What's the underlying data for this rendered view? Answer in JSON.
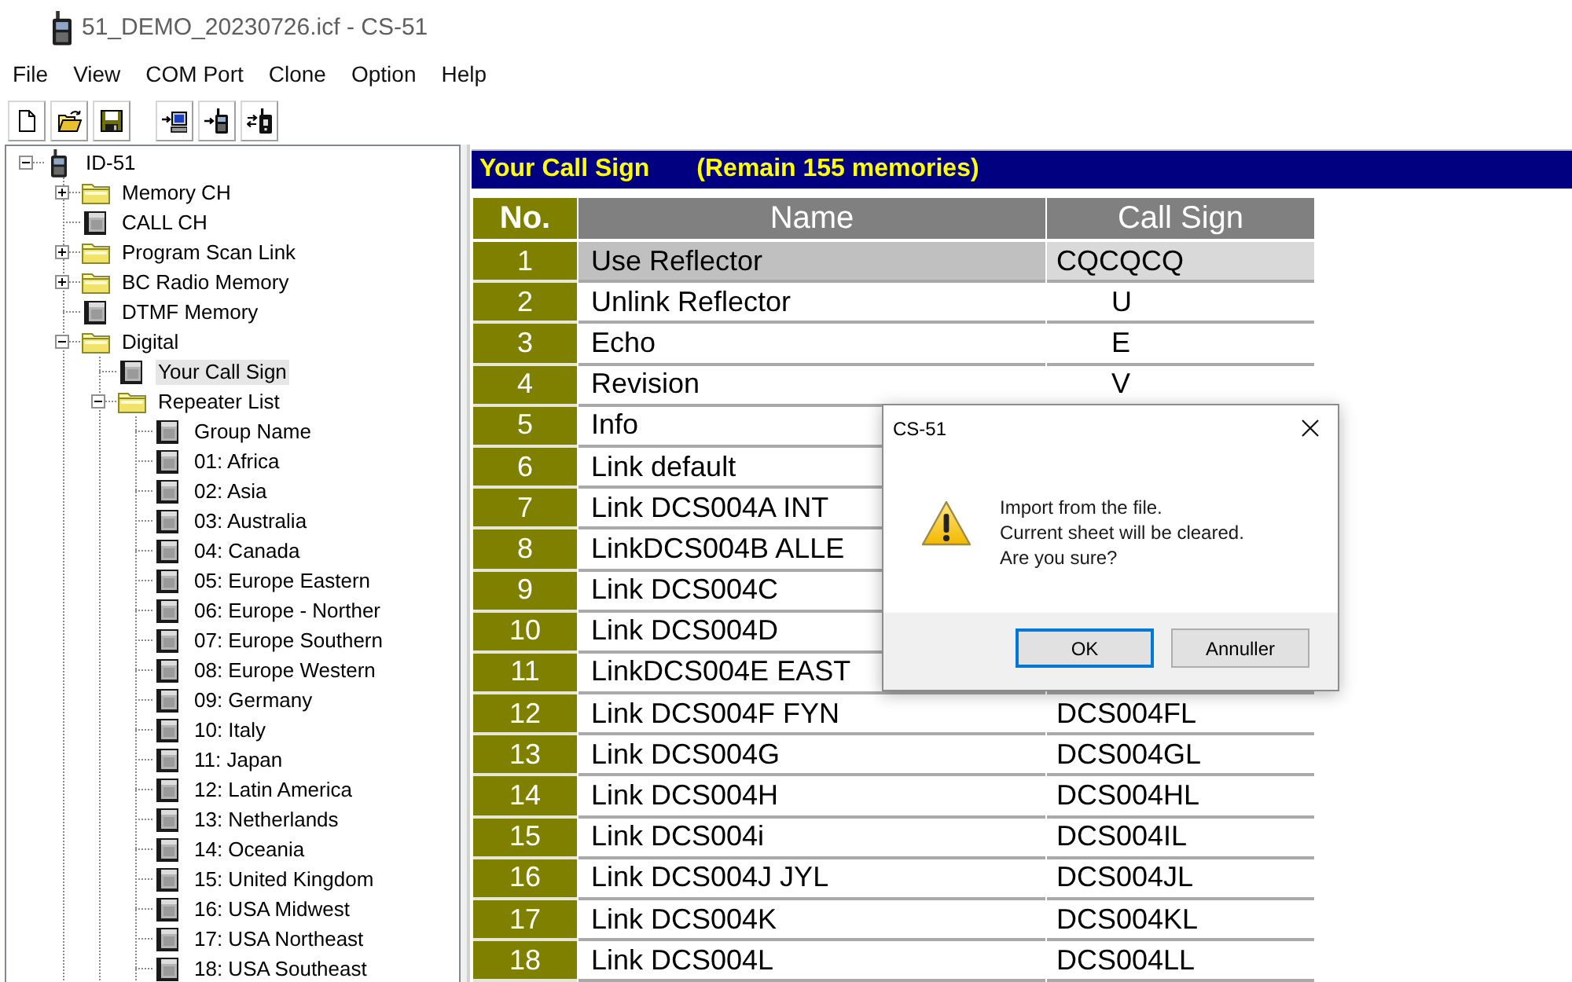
{
  "window": {
    "title": "51_DEMO_20230726.icf - CS-51"
  },
  "menu": [
    "File",
    "View",
    "COM Port",
    "Clone",
    "Option",
    "Help"
  ],
  "tree": {
    "label": "ID-51",
    "kind": "radio",
    "expanded": true,
    "selected": false,
    "children": [
      {
        "label": "Memory CH",
        "kind": "folder",
        "expanded": false,
        "selected": false
      },
      {
        "label": "CALL CH",
        "kind": "sheet",
        "selected": false
      },
      {
        "label": "Program Scan Link",
        "kind": "folder",
        "expanded": false,
        "selected": false
      },
      {
        "label": "BC Radio Memory",
        "kind": "folder",
        "expanded": false,
        "selected": false
      },
      {
        "label": "DTMF Memory",
        "kind": "sheet",
        "selected": false
      },
      {
        "label": "Digital",
        "kind": "folder",
        "expanded": true,
        "selected": false,
        "children": [
          {
            "label": "Your Call Sign",
            "kind": "sheet",
            "selected": true
          },
          {
            "label": "Repeater List",
            "kind": "folder",
            "expanded": true,
            "selected": false,
            "children": [
              {
                "label": "Group Name",
                "kind": "sheet",
                "selected": false
              },
              {
                "label": "01: Africa",
                "kind": "sheet",
                "selected": false
              },
              {
                "label": "02: Asia",
                "kind": "sheet",
                "selected": false
              },
              {
                "label": "03: Australia",
                "kind": "sheet",
                "selected": false
              },
              {
                "label": "04: Canada",
                "kind": "sheet",
                "selected": false
              },
              {
                "label": "05: Europe Eastern",
                "kind": "sheet",
                "selected": false
              },
              {
                "label": "06: Europe - Norther",
                "kind": "sheet",
                "selected": false
              },
              {
                "label": "07: Europe Southern",
                "kind": "sheet",
                "selected": false
              },
              {
                "label": "08: Europe Western",
                "kind": "sheet",
                "selected": false
              },
              {
                "label": "09: Germany",
                "kind": "sheet",
                "selected": false
              },
              {
                "label": "10: Italy",
                "kind": "sheet",
                "selected": false
              },
              {
                "label": "11: Japan",
                "kind": "sheet",
                "selected": false
              },
              {
                "label": "12: Latin America",
                "kind": "sheet",
                "selected": false
              },
              {
                "label": "13: Netherlands",
                "kind": "sheet",
                "selected": false
              },
              {
                "label": "14: Oceania",
                "kind": "sheet",
                "selected": false
              },
              {
                "label": "15: United Kingdom",
                "kind": "sheet",
                "selected": false
              },
              {
                "label": "16: USA Midwest",
                "kind": "sheet",
                "selected": false
              },
              {
                "label": "17: USA Northeast",
                "kind": "sheet",
                "selected": false
              },
              {
                "label": "18: USA Southeast",
                "kind": "sheet",
                "selected": false
              }
            ]
          }
        ]
      }
    ]
  },
  "panel": {
    "title": "Your Call Sign",
    "remain": "(Remain 155 memories)"
  },
  "table": {
    "columns": [
      "No.",
      "Name",
      "Call Sign"
    ],
    "rows": [
      {
        "no": "1",
        "name": "Use Reflector",
        "call_sign": "CQCQCQ",
        "selected": true
      },
      {
        "no": "2",
        "name": "Unlink Reflector",
        "call_sign": "       U",
        "selected": false
      },
      {
        "no": "3",
        "name": "Echo",
        "call_sign": "       E",
        "selected": false
      },
      {
        "no": "4",
        "name": "Revision",
        "call_sign": "       V",
        "selected": false
      },
      {
        "no": "5",
        "name": "Info",
        "selected": false
      },
      {
        "no": "6",
        "name": "Link default",
        "selected": false
      },
      {
        "no": "7",
        "name": "Link DCS004A INT",
        "selected": false
      },
      {
        "no": "8",
        "name": "LinkDCS004B ALLE",
        "selected": false
      },
      {
        "no": "9",
        "name": "Link DCS004C",
        "selected": false
      },
      {
        "no": "10",
        "name": "Link DCS004D",
        "selected": false
      },
      {
        "no": "11",
        "name": "LinkDCS004E EAST",
        "selected": false
      },
      {
        "no": "12",
        "name": "Link DCS004F FYN",
        "call_sign": "DCS004FL",
        "selected": false
      },
      {
        "no": "13",
        "name": "Link DCS004G",
        "call_sign": "DCS004GL",
        "selected": false
      },
      {
        "no": "14",
        "name": "Link DCS004H",
        "call_sign": "DCS004HL",
        "selected": false
      },
      {
        "no": "15",
        "name": "Link DCS004i",
        "call_sign": "DCS004IL",
        "selected": false
      },
      {
        "no": "16",
        "name": "Link DCS004J JYL",
        "call_sign": "DCS004JL",
        "selected": false
      },
      {
        "no": "17",
        "name": "Link DCS004K",
        "call_sign": "DCS004KL",
        "selected": false
      },
      {
        "no": "18",
        "name": "Link DCS004L",
        "call_sign": "DCS004LL",
        "selected": false
      }
    ]
  },
  "dialog": {
    "title": "CS-51",
    "message": "Import from the file.\nCurrent sheet will be cleared.\nAre you sure?",
    "buttons": [
      {
        "label": "OK",
        "default": true
      },
      {
        "label": "Annuller",
        "default": false
      }
    ]
  }
}
